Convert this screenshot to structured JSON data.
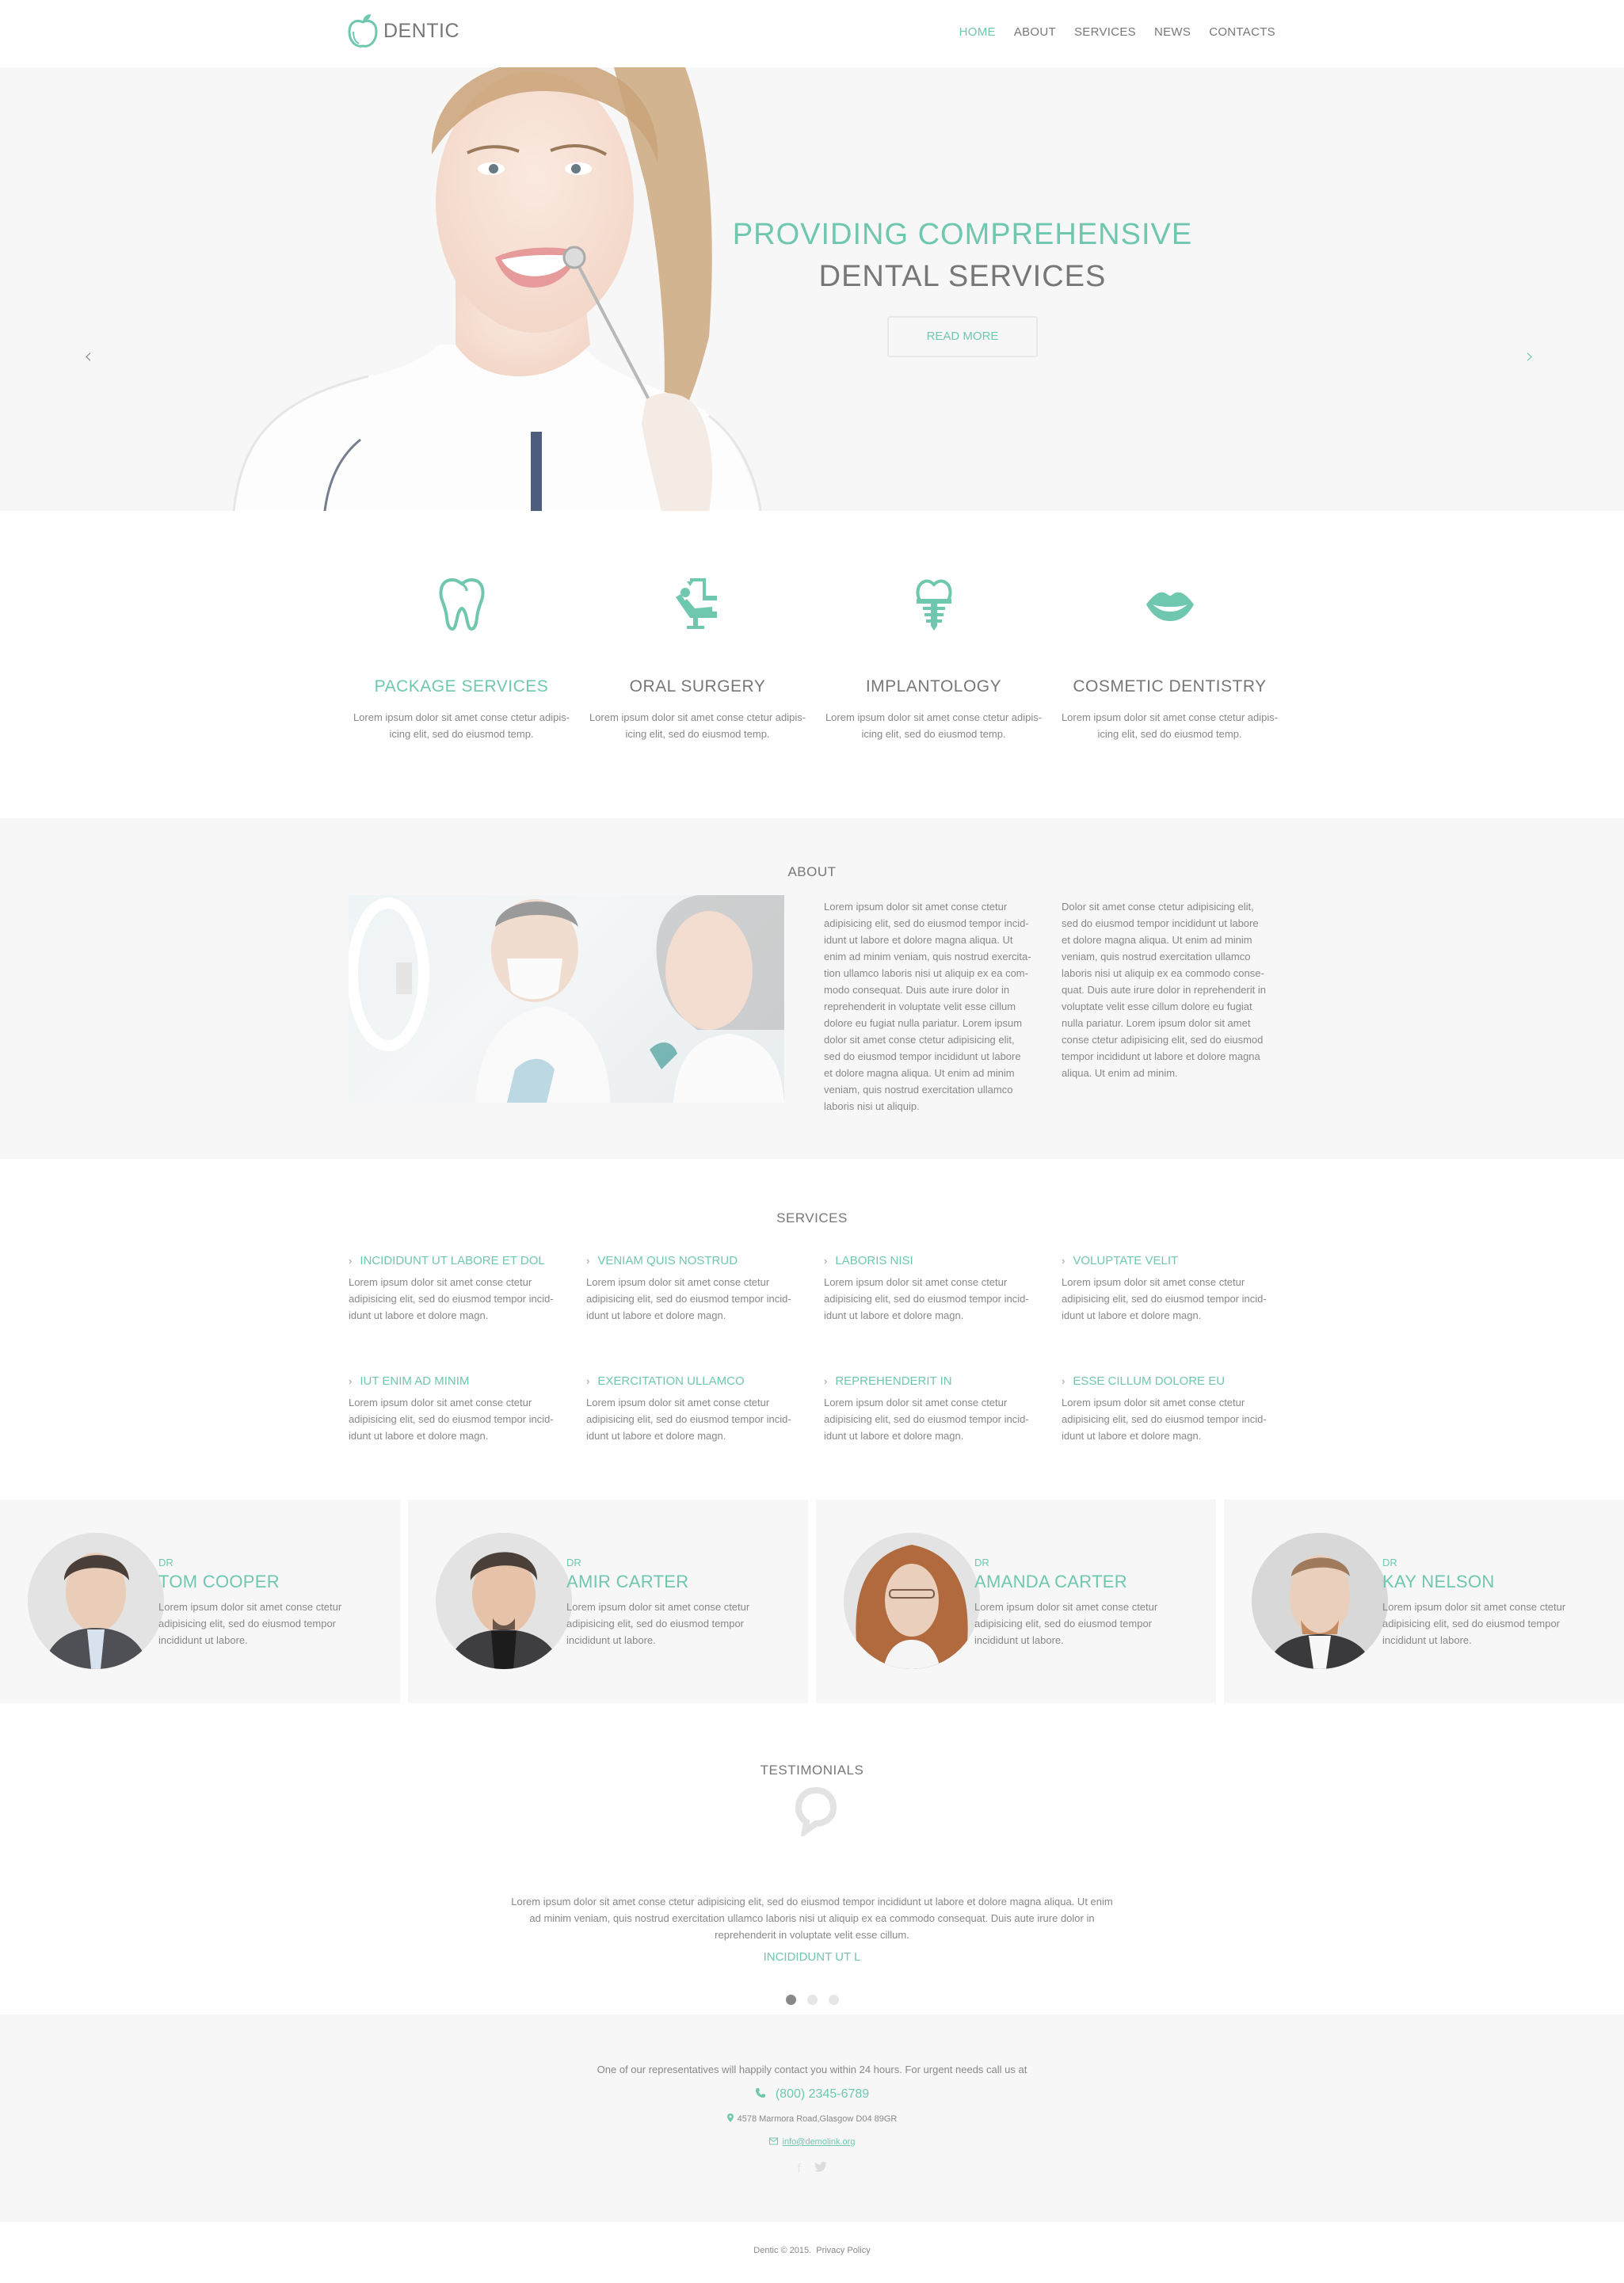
{
  "header": {
    "logo_text": "DENTIC",
    "nav": [
      {
        "label": "HOME",
        "active": true
      },
      {
        "label": "ABOUT",
        "active": false
      },
      {
        "label": "SERVICES",
        "active": false
      },
      {
        "label": "NEWS",
        "active": false
      },
      {
        "label": "CONTACTS",
        "active": false
      }
    ]
  },
  "hero": {
    "line1": "PROVIDING COMPREHENSIVE",
    "line2": "DENTAL SERVICES",
    "button_label": "READ MORE",
    "prev_icon": "chevron-left-icon",
    "next_icon": "chevron-right-icon"
  },
  "features": [
    {
      "icon": "tooth-icon",
      "title": "PACKAGE SERVICES",
      "text": "Lorem ipsum dolor sit amet conse ctetur adipis-icing elit, sed do eiusmod temp."
    },
    {
      "icon": "dental-chair-icon",
      "title": "ORAL SURGERY",
      "text": "Lorem ipsum dolor sit amet conse ctetur adipis-icing elit, sed do eiusmod temp."
    },
    {
      "icon": "dental-implant-icon",
      "title": "IMPLANTOLOGY",
      "text": "Lorem ipsum dolor sit amet conse ctetur adipis-icing elit, sed do eiusmod temp."
    },
    {
      "icon": "lips-icon",
      "title": "COSMETIC DENTISTRY",
      "text": "Lorem ipsum dolor sit amet conse ctetur adipis-icing elit, sed do eiusmod temp."
    }
  ],
  "about": {
    "title": "ABOUT",
    "col1": "Lorem ipsum dolor sit amet conse ctetur adipisicing elit, sed do eiusmod tempor incid-idunt ut labore et dolore magna aliqua. Ut enim ad minim veniam, quis nostrud exercita-tion ullamco laboris nisi ut aliquip ex ea com-modo consequat. Duis aute irure dolor in reprehenderit in voluptate velit esse cillum dolore eu fugiat nulla pariatur. Lorem ipsum dolor sit amet conse ctetur adipisicing elit, sed do eiusmod tempor incididunt ut labore et dolore magna aliqua. Ut enim ad minim veniam, quis nostrud exercitation ullamco laboris nisi ut aliquip.",
    "col2": "Dolor sit amet conse ctetur adipisicing elit, sed do eiusmod tempor incididunt ut labore et dolore magna aliqua. Ut enim ad minim veniam, quis nostrud exercitation ullamco laboris nisi ut aliquip ex ea commodo conse-quat. Duis aute irure dolor in reprehenderit in voluptate velit esse cillum dolore eu fugiat nulla pariatur. Lorem ipsum dolor sit amet conse ctetur adipisicing elit, sed do eiusmod tempor incididunt ut labore et dolore magna aliqua. Ut enim ad minim."
  },
  "services": {
    "title": "SERVICES",
    "items": [
      {
        "title": "INCIDIDUNT UT LABORE ET DOL",
        "text": "Lorem ipsum dolor sit amet conse ctetur adipisicing elit, sed do eiusmod tempor incid-idunt ut labore et dolore magn."
      },
      {
        "title": "VENIAM QUIS NOSTRUD",
        "text": "Lorem ipsum dolor sit amet conse ctetur adipisicing elit, sed do eiusmod tempor incid-idunt ut labore et dolore magn."
      },
      {
        "title": "LABORIS NISI",
        "text": "Lorem ipsum dolor sit amet conse ctetur adipisicing elit, sed do eiusmod tempor incid-idunt ut labore et dolore magn."
      },
      {
        "title": "VOLUPTATE VELIT",
        "text": "Lorem ipsum dolor sit amet conse ctetur adipisicing elit, sed do eiusmod tempor incid-idunt ut labore et dolore magn."
      },
      {
        "title": "IUT ENIM AD MINIM",
        "text": "Lorem ipsum dolor sit amet conse ctetur adipisicing elit, sed do eiusmod tempor incid-idunt ut labore et dolore magn."
      },
      {
        "title": "EXERCITATION ULLAMCO",
        "text": "Lorem ipsum dolor sit amet conse ctetur adipisicing elit, sed do eiusmod tempor incid-idunt ut labore et dolore magn."
      },
      {
        "title": "REPREHENDERIT IN",
        "text": "Lorem ipsum dolor sit amet conse ctetur adipisicing elit, sed do eiusmod tempor incid-idunt ut labore et dolore magn."
      },
      {
        "title": "ESSE CILLUM DOLORE EU",
        "text": "Lorem ipsum dolor sit amet conse ctetur adipisicing elit, sed do eiusmod tempor incid-idunt ut labore et dolore magn."
      }
    ]
  },
  "team": [
    {
      "prefix": "DR",
      "name": "TOM COOPER",
      "text": "Lorem ipsum dolor sit amet conse ctetur adipisicing elit, sed do eiusmod tempor incididunt ut labore."
    },
    {
      "prefix": "DR",
      "name": "AMIR CARTER",
      "text": "Lorem ipsum dolor sit amet conse ctetur adipisicing elit, sed do eiusmod tempor incididunt ut labore."
    },
    {
      "prefix": "DR",
      "name": "AMANDA CARTER",
      "text": "Lorem ipsum dolor sit amet conse ctetur adipisicing elit, sed do eiusmod tempor incididunt ut labore."
    },
    {
      "prefix": "DR",
      "name": "KAY  NELSON",
      "text": "Lorem ipsum dolor sit amet conse ctetur adipisicing elit, sed do eiusmod tempor incididunt ut labore."
    }
  ],
  "testimonials": {
    "title": "TESTIMONIALS",
    "text": "Lorem ipsum dolor sit amet conse ctetur adipisicing elit, sed do eiusmod tempor incididunt ut labore et dolore magna aliqua. Ut enim ad minim veniam, quis nostrud exercitation ullamco laboris nisi ut aliquip ex ea commodo consequat. Duis aute irure dolor in reprehenderit in voluptate velit esse cillum.",
    "author": "INCIDIDUNT UT L",
    "slides": 3,
    "active_slide": 1
  },
  "contact": {
    "intro": "One of our representatives will happily contact you within 24 hours. For urgent needs call us at",
    "phone": "(800) 2345-6789",
    "address": "4578 Marmora Road,Glasgow D04 89GR",
    "email": "info@demolink.org",
    "social": [
      {
        "icon": "facebook-icon",
        "glyph": "f"
      },
      {
        "icon": "twitter-icon",
        "glyph": "🐦"
      }
    ]
  },
  "footer": {
    "copyright": "Dentic © 2015.",
    "privacy": "Privacy Policy"
  },
  "colors": {
    "accent": "#6fc7b0",
    "text": "#777777",
    "section_bg": "#f7f7f7"
  }
}
